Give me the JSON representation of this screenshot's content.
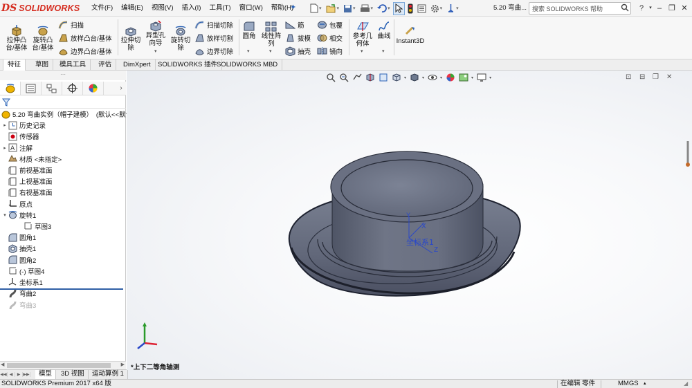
{
  "app": {
    "brand_prefix": "DS",
    "brand_name": "SOLIDWORKS",
    "document_title": "5.20 弯曲...",
    "help_search_placeholder": "搜索 SOLIDWORKS 帮助"
  },
  "menu": [
    {
      "label": "文件(F)"
    },
    {
      "label": "编辑(E)"
    },
    {
      "label": "视图(V)"
    },
    {
      "label": "插入(I)"
    },
    {
      "label": "工具(T)"
    },
    {
      "label": "窗口(W)"
    },
    {
      "label": "帮助(H)"
    }
  ],
  "quick_access_icons": [
    "new-document-icon",
    "open-icon",
    "save-icon",
    "print-icon",
    "undo-icon",
    "select-arrow-icon",
    "traffic-light-icon",
    "file-properties-icon",
    "options-gear-icon",
    "pin-icon"
  ],
  "command_manager": {
    "extrude_boss": "拉伸凸\n台/基体",
    "revolve_boss": "旋转凸\n台/基体",
    "sweep": "扫描",
    "loft_boss": "放样凸台/基体",
    "boundary_boss": "边界凸台/基体",
    "extrude_cut": "拉伸切\n除",
    "hole_wizard": "异型孔\n向导",
    "revolve_cut": "旋转切\n除",
    "swept_cut": "扫描切除",
    "lofted_cut": "放样切割",
    "boundary_cut": "边界切除",
    "fillet": "圆角",
    "linear_pattern": "线性阵\n列",
    "rib": "筋",
    "draft": "拔模",
    "shell": "抽壳",
    "wrap": "包覆",
    "intersect": "相交",
    "mirror": "镜向",
    "reference_geometry": "参考几\n何体",
    "curves": "曲线",
    "instant3d": "Instant3D"
  },
  "cm_tabs": [
    {
      "label": "特征",
      "active": true
    },
    {
      "label": "草图"
    },
    {
      "label": "模具工具"
    },
    {
      "label": "评估"
    },
    {
      "label": "DimXpert"
    },
    {
      "label": "SOLIDWORKS 插件"
    },
    {
      "label": "SOLIDWORKS MBD"
    }
  ],
  "feature_tree": {
    "root": "5.20 弯曲实例（帽子建模）　(默认<<默认",
    "items": [
      {
        "label": "历史记录",
        "icon": "history-icon",
        "expandable": true
      },
      {
        "label": "传感器",
        "icon": "sensor-icon"
      },
      {
        "label": "注解",
        "icon": "annotations-icon",
        "expandable": true
      },
      {
        "label": "材质 <未指定>",
        "icon": "material-icon"
      },
      {
        "label": "前视基准面",
        "icon": "plane-icon"
      },
      {
        "label": "上视基准面",
        "icon": "plane-icon"
      },
      {
        "label": "右视基准面",
        "icon": "plane-icon"
      },
      {
        "label": "原点",
        "icon": "origin-icon"
      },
      {
        "label": "旋转1",
        "icon": "revolve-icon",
        "expandable": true,
        "expanded": true
      },
      {
        "label": "草图3",
        "icon": "sketch-icon",
        "indent": 1
      },
      {
        "label": "圆角1",
        "icon": "fillet-icon"
      },
      {
        "label": "抽壳1",
        "icon": "shell-icon"
      },
      {
        "label": "圆角2",
        "icon": "fillet-icon"
      },
      {
        "label": "(-) 草图4",
        "icon": "sketch-icon"
      },
      {
        "label": "坐标系1",
        "icon": "coordinate-system-icon"
      },
      {
        "label": "弯曲2",
        "icon": "flex-icon"
      },
      {
        "label": "弯曲3",
        "icon": "flex-icon",
        "suppressed": true
      }
    ]
  },
  "viewport": {
    "view_orientation_label": "*上下二等角轴测",
    "coordinate_system_label": "坐标系1",
    "axis_labels": {
      "x": "X",
      "y": "Y",
      "z": "Z"
    }
  },
  "bottom_tabs": [
    {
      "label": "模型",
      "active": true
    },
    {
      "label": "3D 视图"
    },
    {
      "label": "运动算例 1"
    }
  ],
  "status": {
    "product": "SOLIDWORKS Premium 2017 x64 版",
    "mode": "在编辑 零件",
    "units": "MMGS"
  },
  "colors": {
    "brand_red": "#d52b1e",
    "model_gray": "#5f6470",
    "selection_blue": "#2f5fa6"
  }
}
